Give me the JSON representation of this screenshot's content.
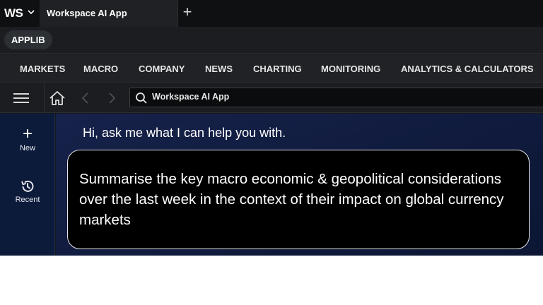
{
  "app": {
    "logo_text": "WS",
    "tab_title": "Workspace AI App"
  },
  "applib": {
    "label": "APPLIB"
  },
  "menu": {
    "items": [
      "MARKETS",
      "MACRO",
      "COMPANY",
      "NEWS",
      "CHARTING",
      "MONITORING",
      "ANALYTICS & CALCULATORS"
    ]
  },
  "toolbar": {
    "search_value": "Workspace AI App"
  },
  "sidebar": {
    "new_label": "New",
    "recent_label": "Recent"
  },
  "chat": {
    "greeting": "Hi, ask me what I can help you with.",
    "prompt": "Summarise the key macro economic & geopolitical considerations over the last week in the context of their impact on global currency markets"
  },
  "colors": {
    "sidebar_bg": "#0d1b3a",
    "main_bg": "#16224a",
    "bubble_bg": "#000000"
  }
}
